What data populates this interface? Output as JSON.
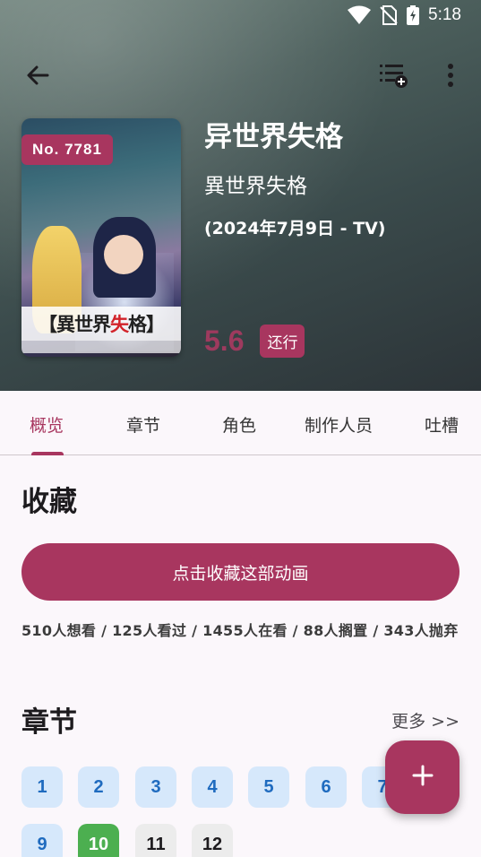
{
  "status_bar": {
    "time": "5:18"
  },
  "anime": {
    "rank": "No. 7781",
    "title": "异世界失格",
    "subtitle": "異世界失格",
    "date": "(2024年7月9日 - TV)",
    "score": "5.6",
    "status": "还行",
    "poster_title_left": "【異世界",
    "poster_title_red": "失",
    "poster_title_right": "格】"
  },
  "tabs": [
    {
      "label": "概览",
      "active": true
    },
    {
      "label": "章节"
    },
    {
      "label": "角色"
    },
    {
      "label": "制作人员"
    },
    {
      "label": "吐槽"
    }
  ],
  "collection": {
    "title": "收藏",
    "button_label": "点击收藏这部动画",
    "stats": "510人想看 / 125人看过 / 1455人在看 / 88人搁置 / 343人抛弃"
  },
  "episodes": {
    "title": "章节",
    "more_label": "更多 >>",
    "items": [
      {
        "label": "1",
        "state": "aired"
      },
      {
        "label": "2",
        "state": "aired"
      },
      {
        "label": "3",
        "state": "aired"
      },
      {
        "label": "4",
        "state": "aired"
      },
      {
        "label": "5",
        "state": "aired"
      },
      {
        "label": "6",
        "state": "aired"
      },
      {
        "label": "7",
        "state": "aired"
      },
      {
        "label": "9",
        "state": "aired"
      },
      {
        "label": "10",
        "state": "current"
      },
      {
        "label": "11",
        "state": "future"
      },
      {
        "label": "12",
        "state": "future"
      }
    ]
  },
  "colors": {
    "accent": "#a8365f",
    "aired_bg": "#d6e8fb",
    "aired_text": "#1f6bbf",
    "current_bg": "#4caf50",
    "future_bg": "#ececec"
  },
  "icons": {
    "back": "arrow-back-icon",
    "queue": "playlist-add-icon",
    "more": "more-vert-icon",
    "fab": "plus-icon"
  }
}
